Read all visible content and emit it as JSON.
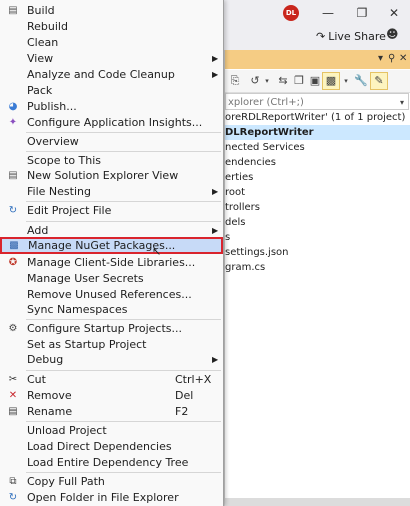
{
  "window": {
    "avatar_initials": "DL",
    "live_share_label": "Live Share",
    "min_icon": "minimize-icon",
    "restore_icon": "restore-icon",
    "close_icon": "close-icon"
  },
  "solution_explorer": {
    "search_placeholder": "xplorer (Ctrl+;)",
    "tree": [
      "oreRDLReportWriter' (1 of 1 project)",
      "DLReportWriter",
      "nected Services",
      "endencies",
      "erties",
      "root",
      "trollers",
      "dels",
      "s",
      "settings.json",
      "gram.cs"
    ]
  },
  "menu": {
    "items": [
      {
        "label": "Build",
        "icon": "build-icon"
      },
      {
        "label": "Rebuild",
        "icon": ""
      },
      {
        "label": "Clean",
        "icon": ""
      },
      {
        "label": "View",
        "icon": "",
        "submenu": true
      },
      {
        "label": "Analyze and Code Cleanup",
        "icon": "",
        "submenu": true
      },
      {
        "label": "Pack",
        "icon": ""
      },
      {
        "label": "Publish...",
        "icon": "publish-icon"
      },
      {
        "label": "Configure Application Insights...",
        "icon": "insights-icon"
      },
      {
        "label": "Overview",
        "icon": ""
      },
      {
        "label": "Scope to This",
        "icon": ""
      },
      {
        "label": "New Solution Explorer View",
        "icon": "new-view-icon"
      },
      {
        "label": "File Nesting",
        "icon": "",
        "submenu": true
      },
      {
        "label": "Edit Project File",
        "icon": "edit-icon"
      },
      {
        "label": "Add",
        "icon": "",
        "submenu": true
      },
      {
        "label": "Manage NuGet Packages...",
        "icon": "nuget-icon",
        "highlighted": true
      },
      {
        "label": "Manage Client-Side Libraries...",
        "icon": "libraries-icon"
      },
      {
        "label": "Manage User Secrets",
        "icon": ""
      },
      {
        "label": "Remove Unused References...",
        "icon": ""
      },
      {
        "label": "Sync Namespaces",
        "icon": ""
      },
      {
        "label": "Configure Startup Projects...",
        "icon": "gear-icon"
      },
      {
        "label": "Set as Startup Project",
        "icon": ""
      },
      {
        "label": "Debug",
        "icon": "",
        "submenu": true
      },
      {
        "label": "Cut",
        "icon": "cut-icon",
        "shortcut": "Ctrl+X"
      },
      {
        "label": "Remove",
        "icon": "remove-icon",
        "shortcut": "Del"
      },
      {
        "label": "Rename",
        "icon": "rename-icon",
        "shortcut": "F2"
      },
      {
        "label": "Unload Project",
        "icon": ""
      },
      {
        "label": "Load Direct Dependencies",
        "icon": ""
      },
      {
        "label": "Load Entire Dependency Tree",
        "icon": ""
      },
      {
        "label": "Copy Full Path",
        "icon": "copy-icon"
      },
      {
        "label": "Open Folder in File Explorer",
        "icon": "refresh-icon"
      }
    ]
  },
  "colors": {
    "highlight_fill": "#c7daf7",
    "highlight_border": "#d9242d",
    "panel_header": "#f5cc84",
    "tree_selection": "#cce8ff"
  }
}
